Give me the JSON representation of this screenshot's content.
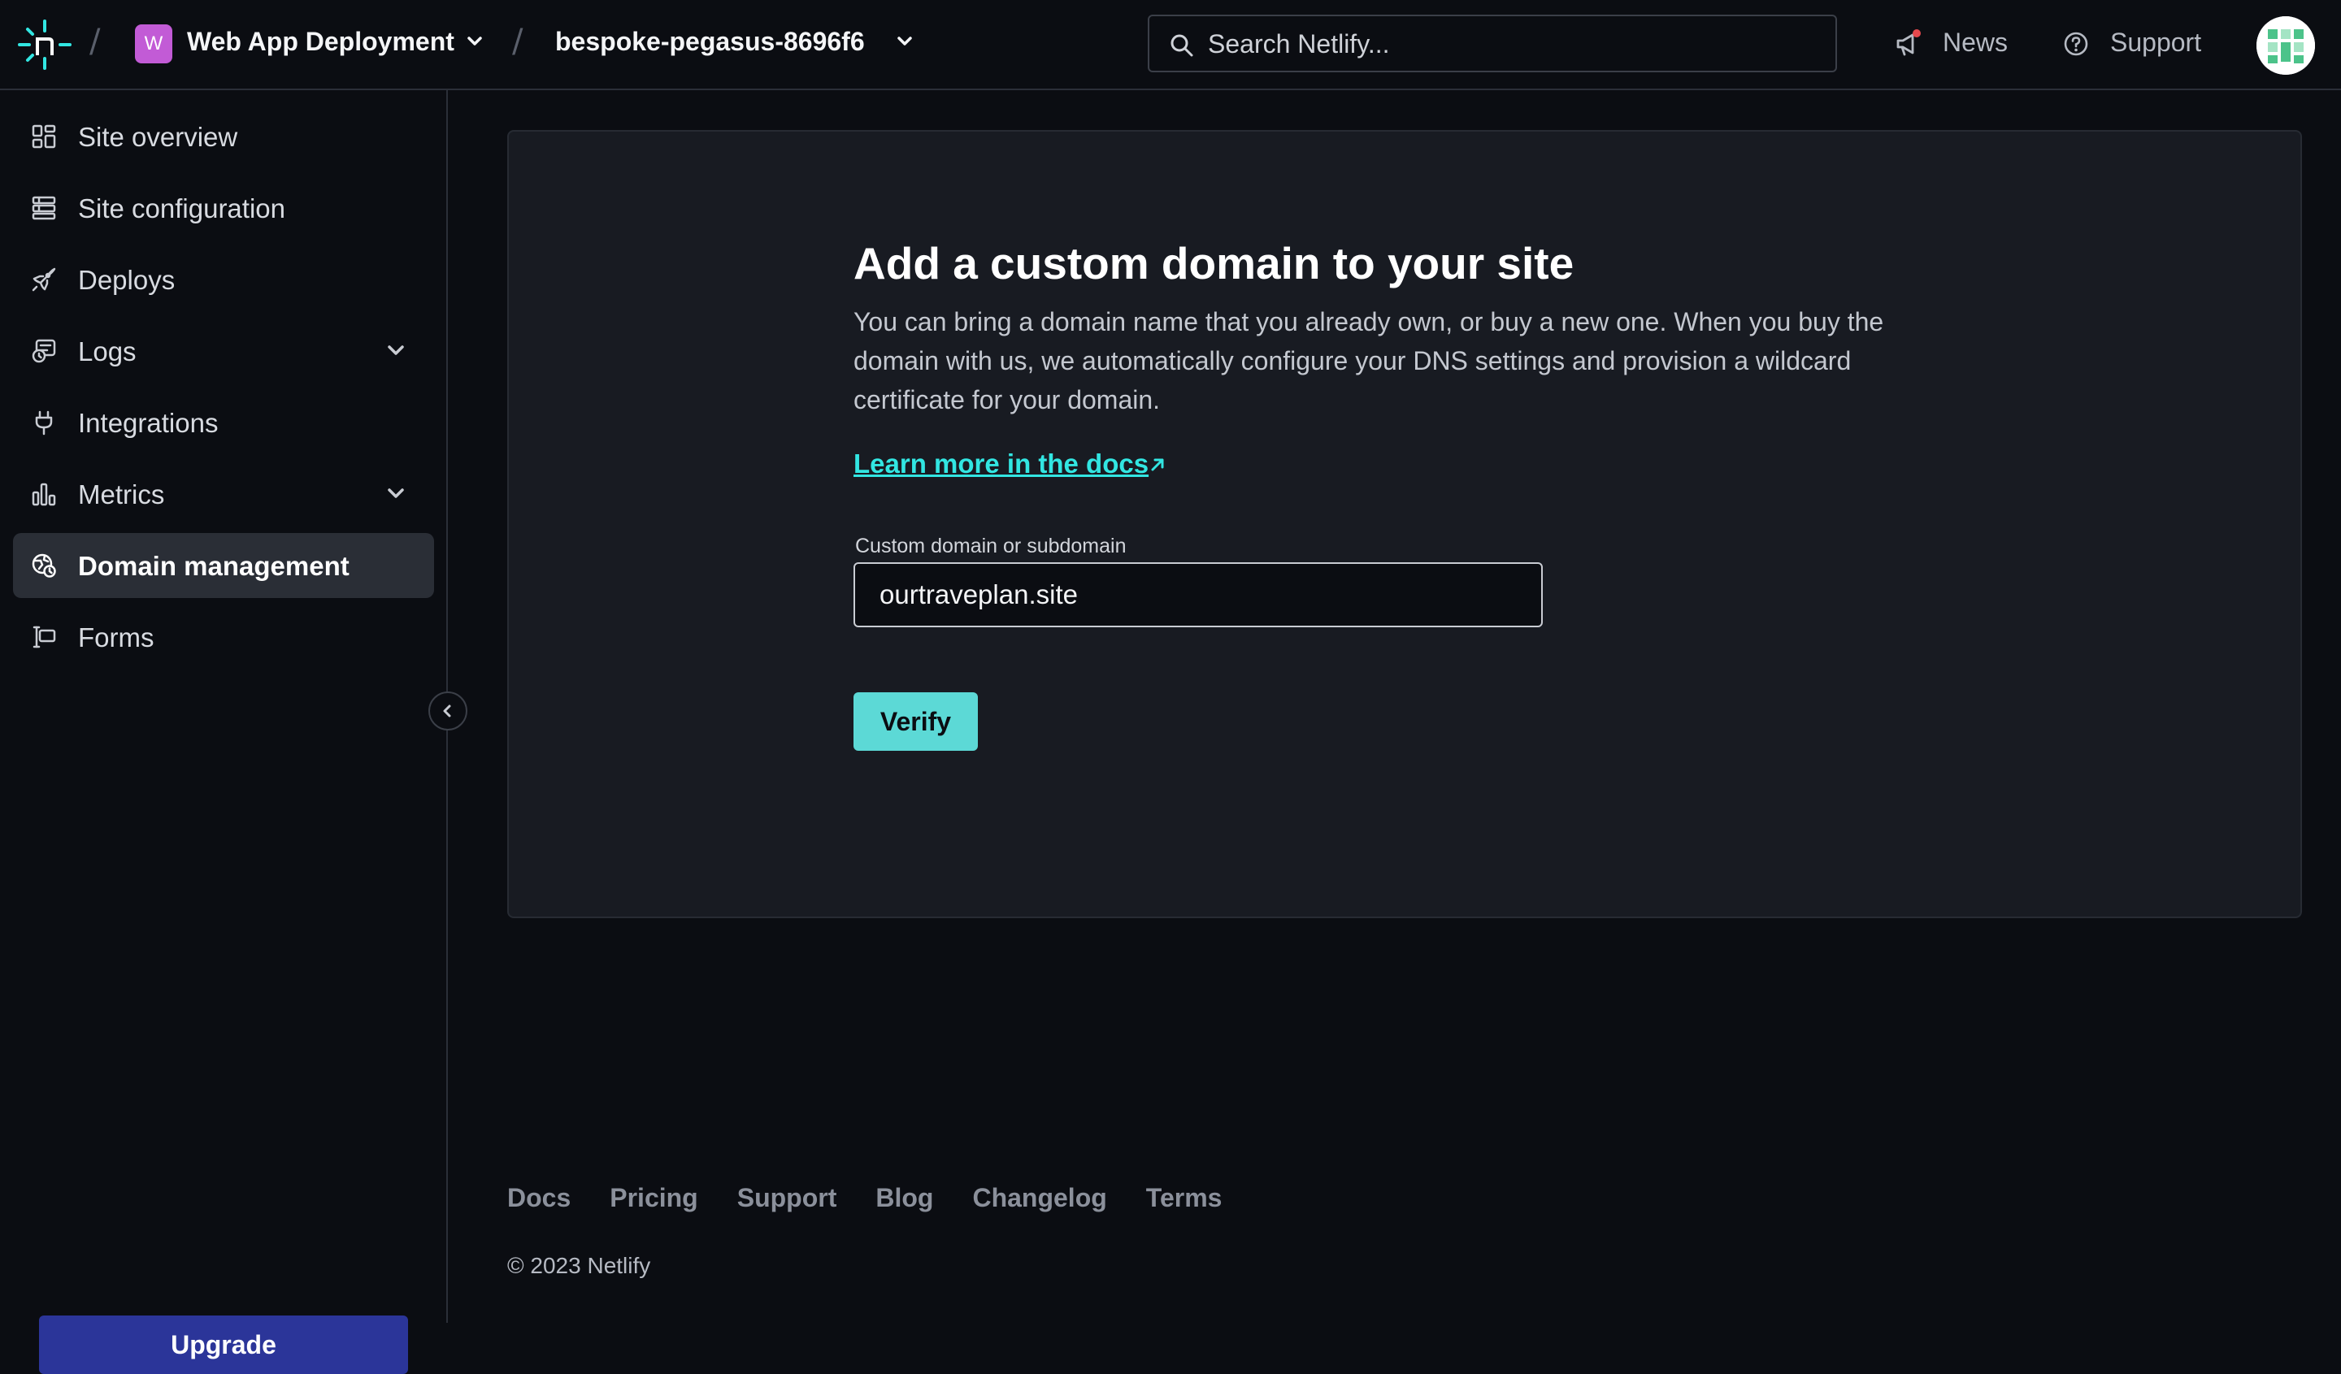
{
  "header": {
    "breadcrumb_sep": "/",
    "team_initial": "W",
    "team_name": "Web App Deployment",
    "site_name": "bespoke-pegasus-8696f6",
    "search_placeholder": "Search Netlify...",
    "news_label": "News",
    "support_label": "Support"
  },
  "sidebar": {
    "items": [
      {
        "label": "Site overview",
        "icon": "grid-icon"
      },
      {
        "label": "Site configuration",
        "icon": "settings-stack-icon"
      },
      {
        "label": "Deploys",
        "icon": "rocket-icon"
      },
      {
        "label": "Logs",
        "icon": "logs-icon",
        "expandable": true
      },
      {
        "label": "Integrations",
        "icon": "plug-icon"
      },
      {
        "label": "Metrics",
        "icon": "bar-chart-icon",
        "expandable": true
      },
      {
        "label": "Domain management",
        "icon": "globe-icon",
        "active": true
      },
      {
        "label": "Forms",
        "icon": "form-icon"
      }
    ],
    "upgrade_label": "Upgrade"
  },
  "main": {
    "title": "Add a custom domain to your site",
    "description": "You can bring a domain name that you already own, or buy a new one. When you buy the domain with us, we automatically configure your DNS settings and provision a wildcard certificate for your domain.",
    "docs_link": "Learn more in the docs",
    "field_label": "Custom domain or subdomain",
    "field_value": "ourtraveplan.site",
    "verify_label": "Verify"
  },
  "footer": {
    "links": [
      "Docs",
      "Pricing",
      "Support",
      "Blog",
      "Changelog",
      "Terms"
    ],
    "copyright": "© 2023 Netlify"
  },
  "colors": {
    "accent": "#32e6e2",
    "button_teal": "#5cd9d6",
    "upgrade_blue": "#2b3599",
    "team_badge": "#c25bd6",
    "background": "#0b0d12",
    "card": "#181b22"
  }
}
